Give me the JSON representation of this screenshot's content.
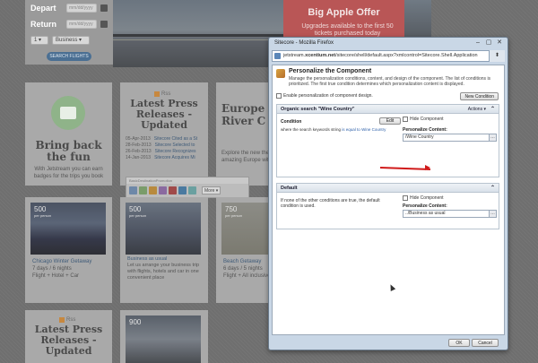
{
  "site": {
    "flight": {
      "depart_label": "Depart",
      "return_label": "Return",
      "depart_placeholder": "mm/dd/yyyy",
      "return_placeholder": "mm/dd/yyyy",
      "passengers": "1",
      "class": "Business",
      "search_label": "SEARCH FLIGHTS"
    },
    "offer": {
      "title": "Big Apple Offer",
      "subtitle": "Upgrades available to the first 50 tickets purchased today"
    },
    "card_fun": {
      "title": "Bring back the fun",
      "text": "With Jetstream you can earn badges for the trips you book"
    },
    "card_press": {
      "rss": "Rss",
      "title": "Latest Press Releases -Updated",
      "rows": [
        {
          "date": "05-Apr-2013",
          "text": "Sitecore Cited as a St"
        },
        {
          "date": "28-Feb-2013",
          "text": "Sitecore Selected to"
        },
        {
          "date": "26-Feb-2013",
          "text": "Sitecore Recognizes"
        },
        {
          "date": "14-Jan-2013",
          "text": "Sitecore Acquires Mi"
        }
      ]
    },
    "card_europe": {
      "title": "Europe River C",
      "text": "Explore the new the amazing Europe with our"
    },
    "deals": [
      {
        "price": "500",
        "per": "per person",
        "title": "Chicago Winter Getaway",
        "line1": "7 days / 6 nights",
        "line2": "Flight + Hotel + Car"
      },
      {
        "price": "500",
        "per": "per person",
        "title": "Business as usual",
        "line1": "Let us arrange your business trip",
        "line2": "with flights, hotels and car in one convenient place"
      },
      {
        "price": "750",
        "per": "per person",
        "title": "Beach Getaway",
        "line1": "6 days / 5 nights",
        "line2": "Flight + All inclusive"
      }
    ],
    "card_press2": {
      "rss": "Rss",
      "title": "Latest Press Releases -Updated"
    },
    "deal_bottom_price": "900"
  },
  "ribbon": {
    "label": "BasicDestinationPromotion",
    "more": "More"
  },
  "window": {
    "title": "Sitecore - Mozilla Firefox",
    "url_host": "jetstream.",
    "url_domain": "xcentium.net",
    "url_path": "/sitecore/shell/default.aspx?xmlcontrol=Sitecore.Shell.Application",
    "dialog": {
      "title": "Personalize the Component",
      "description": "Manage the personalization conditions, content, and design of the component. The list of conditions is prioritized. The first true condition determines which personalization content is displayed.",
      "enable_label": "Enable personalization of component design.",
      "new_condition": "New Condition",
      "rule1": {
        "name": "Organic search \"Wine Country\"",
        "actions": "Actions",
        "condition_label": "Condition",
        "edit": "Edit",
        "condition_prefix": "where the search keywords string",
        "condition_operator": "is equal to",
        "condition_value": "Wine Country",
        "hide_label": "Hide Component",
        "pc_label": "Personalize Content:",
        "pc_value": "/Wine Country"
      },
      "rule2": {
        "name": "Default",
        "text": "If none of the other conditions are true, the default condition is used.",
        "hide_label": "Hide Component",
        "pc_label": "Personalize Content:",
        "pc_value": "../Business as usual"
      },
      "ok": "OK",
      "cancel": "Cancel"
    }
  },
  "colors": {
    "offer_bg": "#b95656",
    "arrow": "#d01a1a",
    "link": "#2b5ea8"
  }
}
